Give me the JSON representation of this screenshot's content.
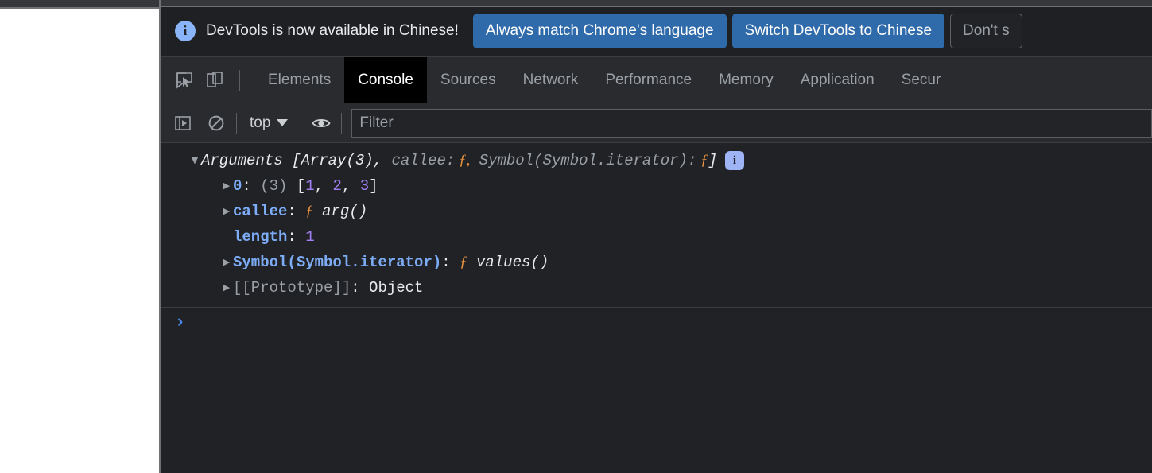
{
  "banner": {
    "icon": "info-circle-icon",
    "message": "DevTools is now available in Chinese!",
    "primary_button_1": "Always match Chrome's language",
    "primary_button_2": "Switch DevTools to Chinese",
    "secondary_button": "Don't s",
    "accent_color": "#2f6aab",
    "icon_color": "#8ab4f8"
  },
  "tabbar": {
    "inspect_icon": "inspect-cursor-icon",
    "device_toolbar_icon": "device-toolbar-icon",
    "tabs": [
      {
        "label": "Elements",
        "active": false
      },
      {
        "label": "Console",
        "active": true
      },
      {
        "label": "Sources",
        "active": false
      },
      {
        "label": "Network",
        "active": false
      },
      {
        "label": "Performance",
        "active": false
      },
      {
        "label": "Memory",
        "active": false
      },
      {
        "label": "Application",
        "active": false
      },
      {
        "label": "Secur",
        "active": false
      }
    ]
  },
  "console_toolbar": {
    "sidebar_toggle_icon": "console-sidebar-icon",
    "clear_console_icon": "clear-console-icon",
    "context": "top",
    "context_caret_icon": "chevron-down-icon",
    "eye_icon": "live-expression-icon",
    "filter_placeholder": "Filter",
    "filter_value": ""
  },
  "console_output": {
    "header": {
      "toggle_icon": "triangle-down-icon",
      "object_name": "Arguments",
      "open_bracket": " [",
      "array_summary": "Array(3),",
      "callee_key": " callee:",
      "callee_fn": " ƒ,",
      "symbol_key": " Symbol(Symbol.iterator):",
      "symbol_fn": " ƒ",
      "close_bracket": "]",
      "badge": "i"
    },
    "rows": [
      {
        "toggle_icon": "triangle-right-icon",
        "key": "0",
        "colon": ": ",
        "count": "(3)",
        "space": " ",
        "bracket_open": "[",
        "values": [
          "1",
          "2",
          "3"
        ],
        "bracket_close": "]"
      },
      {
        "toggle_icon": "triangle-right-icon",
        "key": "callee",
        "colon": ": ",
        "fn_glyph": "ƒ",
        "fn_name": " arg()"
      },
      {
        "toggle_icon": "none",
        "key": "length",
        "colon": ": ",
        "value": "1"
      },
      {
        "toggle_icon": "triangle-right-icon",
        "key": "Symbol(Symbol.iterator)",
        "colon": ": ",
        "fn_glyph": "ƒ",
        "fn_name": " values()"
      },
      {
        "toggle_icon": "triangle-right-icon",
        "key": "[[Prototype]]",
        "colon": ": ",
        "value": "Object"
      }
    ],
    "prompt_caret": "›"
  }
}
